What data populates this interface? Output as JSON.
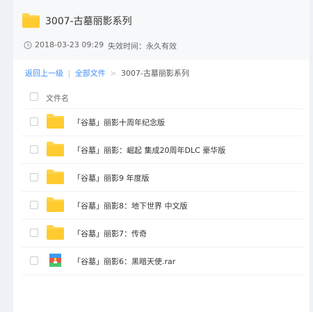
{
  "share": {
    "title": "3007-古墓丽影系列",
    "date": "2018-03-23 09:29",
    "expiry": "失效时间：永久有效"
  },
  "breadcrumb": {
    "back": "返回上一级",
    "divider": "|",
    "all_files": "全部文件",
    "arrow": ">",
    "current": "3007-古墓丽影系列"
  },
  "list": {
    "header": "文件名",
    "files": [
      {
        "name": "「谷墓」丽影十周年纪念版",
        "type": "folder"
      },
      {
        "name": "「谷墓」丽影：崛起 集成20周年DLC 豪华版",
        "type": "folder"
      },
      {
        "name": "「谷墓」丽影9 年度版",
        "type": "folder"
      },
      {
        "name": "「谷墓」丽影8：地下世界 中文版",
        "type": "folder"
      },
      {
        "name": "「谷墓」丽影7：传奇",
        "type": "folder"
      },
      {
        "name": "「谷墓」丽影6：黑暗天使.rar",
        "type": "archive"
      }
    ]
  },
  "colors": {
    "folder": "#ffd44c",
    "link": "#3b8cff",
    "header_bg": "#f7f8fa",
    "rail": "#eef1f6"
  }
}
